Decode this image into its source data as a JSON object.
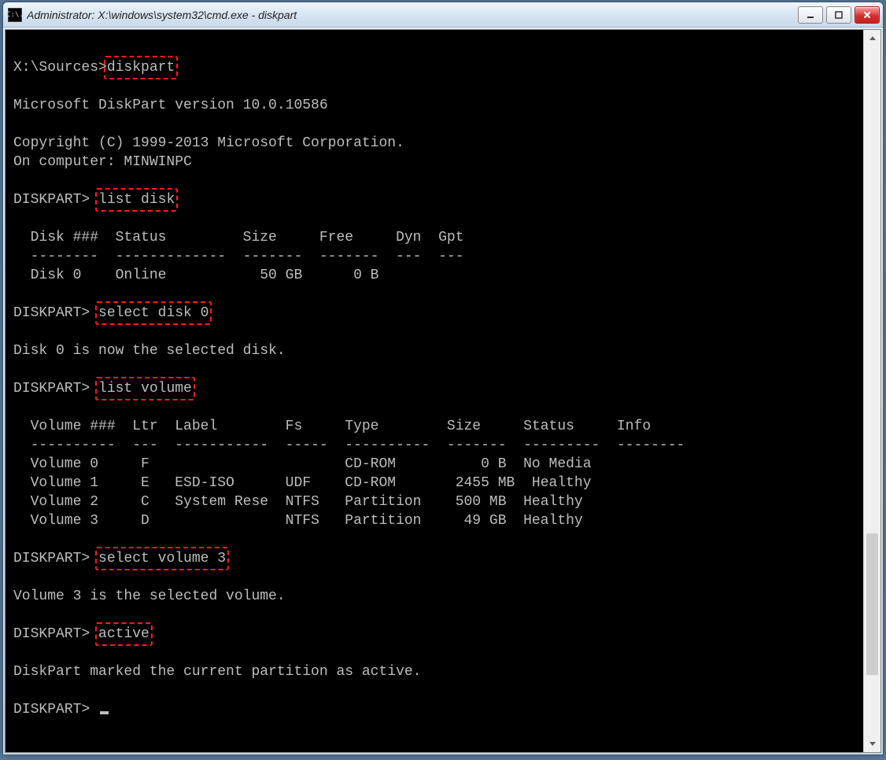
{
  "window": {
    "title": "Administrator: X:\\windows\\system32\\cmd.exe - diskpart"
  },
  "terminal": {
    "prompt1": "X:\\Sources>",
    "cmd_diskpart": "diskpart",
    "version_line": "Microsoft DiskPart version 10.0.10586",
    "copyright_line": "Copyright (C) 1999-2013 Microsoft Corporation.",
    "computer_line": "On computer: MINWINPC",
    "diskpart_prompt": "DISKPART> ",
    "cmd_list_disk": "list disk",
    "disk_header": "  Disk ###  Status         Size     Free     Dyn  Gpt",
    "disk_divider": "  --------  -------------  -------  -------  ---  ---",
    "disk_row0": "  Disk 0    Online           50 GB      0 B",
    "cmd_select_disk": "select disk 0",
    "disk_selected_msg": "Disk 0 is now the selected disk.",
    "cmd_list_volume": "list volume",
    "vol_header": "  Volume ###  Ltr  Label        Fs     Type        Size     Status     Info",
    "vol_divider": "  ----------  ---  -----------  -----  ----------  -------  ---------  --------",
    "vol_row0": "  Volume 0     F                       CD-ROM          0 B  No Media",
    "vol_row1": "  Volume 1     E   ESD-ISO      UDF    CD-ROM       2455 MB  Healthy",
    "vol_row2": "  Volume 2     C   System Rese  NTFS   Partition    500 MB  Healthy",
    "vol_row3": "  Volume 3     D                NTFS   Partition     49 GB  Healthy",
    "cmd_select_volume": "select volume 3",
    "vol_selected_msg": "Volume 3 is the selected volume.",
    "cmd_active": "active",
    "active_msg": "DiskPart marked the current partition as active."
  }
}
